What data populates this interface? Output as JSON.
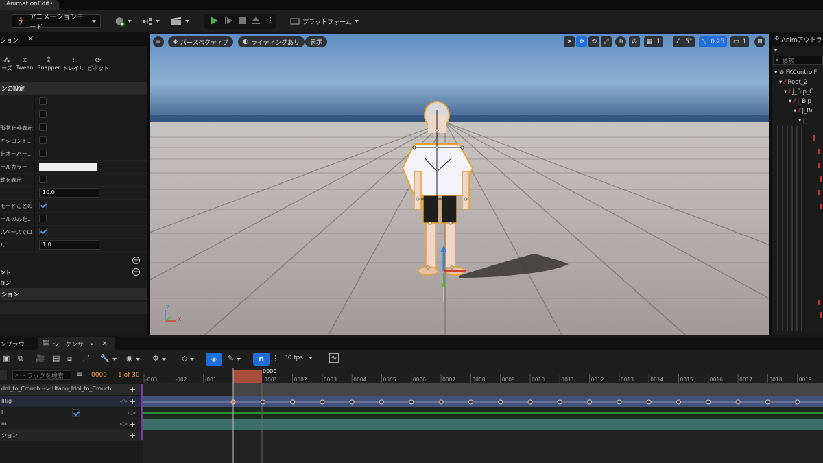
{
  "titlebar": {
    "tab_label": "AnimationEdit•"
  },
  "toolbar": {
    "mode_label": "アニメーションモード",
    "platform_label": "プラットフォーム"
  },
  "details": {
    "panel_tab": "ション",
    "tools": [
      {
        "label": "ーズ"
      },
      {
        "label": "Tween"
      },
      {
        "label": "Snapper"
      },
      {
        "label": "トレイル"
      },
      {
        "label": "ピボット"
      }
    ],
    "section_settings": "ンの設定",
    "rows": [
      {
        "label": "",
        "type": "check",
        "checked": false
      },
      {
        "label": "",
        "type": "check",
        "checked": false
      },
      {
        "label": "形状を非表示",
        "type": "check",
        "checked": false
      },
      {
        "label": "キシコント...",
        "type": "check",
        "checked": false
      },
      {
        "label": "をオーバー...",
        "type": "check",
        "checked": false
      },
      {
        "label": "ールカラー",
        "type": "color"
      },
      {
        "label": "軸を表示",
        "type": "check",
        "checked": false
      },
      {
        "label": "",
        "type": "number",
        "value": "10.0"
      },
      {
        "label": "モードごとの...",
        "type": "check",
        "checked": true
      },
      {
        "label": "ールのみを...",
        "type": "check",
        "checked": false
      },
      {
        "label": "スペースでロ...",
        "type": "check",
        "checked": true
      },
      {
        "label": "ル",
        "type": "number",
        "value": "1.0"
      }
    ],
    "bottom_rows": [
      "ント",
      "ョン"
    ],
    "section_bottom": "ション"
  },
  "viewport": {
    "menu_label": "≡",
    "perspective_label": "パースペクティブ",
    "lighting_label": "ライティングあり",
    "show_label": "表示",
    "grid_value": "1",
    "angle_value": "5°",
    "scale_value": "0.25",
    "camera_value": "1",
    "axis_z": "Z",
    "axis_x": "X"
  },
  "outliner": {
    "title": "Animアウトライ",
    "search_placeholder": "検索",
    "items": [
      "FKControlF",
      "Root_2",
      "J_Bip_C",
      "J_Bip_",
      "J_Bi",
      "J_"
    ]
  },
  "sequencer": {
    "tab_browser": "ンプラウ...",
    "tab_sequencer": "シーケンサー•",
    "fps_label": "30 fps",
    "search_placeholder": "トラックを検索",
    "current_frame": "0000",
    "frame_counter": "1 of 30",
    "playhead_label": "0000",
    "ruler": [
      "-003",
      "-002",
      "-001",
      "0001",
      "0002",
      "0003",
      "0004",
      "0005",
      "0006",
      "0007",
      "0008",
      "0009",
      "0010",
      "0011",
      "0012",
      "0013",
      "0014",
      "0015",
      "0016",
      "0017",
      "0018",
      "0019"
    ],
    "tracks": [
      {
        "label": "dol_to_Crouch --> Utano_Idol_to_Crouch",
        "plus": true
      },
      {
        "label": "lRig",
        "plus": true
      },
      {
        "label": "l",
        "plus": false
      },
      {
        "label": "m",
        "plus": true
      },
      {
        "label": "ション",
        "plus": true
      }
    ]
  },
  "colors": {
    "accent": "#1e6fd9",
    "playhead": "#b5533c",
    "track_blue": "#4a5a8a",
    "track_teal": "#3c6e6a"
  }
}
